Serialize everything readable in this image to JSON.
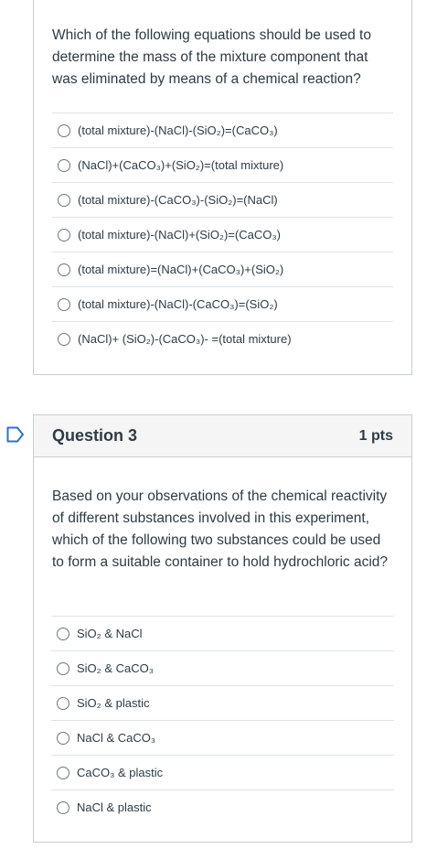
{
  "question2": {
    "text": "Which of the following equations should be used to determine the mass of the mixture component that was eliminated by means of a chemical reaction?",
    "answers": [
      "(total mixture)-(NaCl)-(SiO₂)=(CaCO₃)",
      "(NaCl)+(CaCO₃)+(SiO₂)=(total mixture)",
      "(total mixture)-(CaCO₃)-(SiO₂)=(NaCl)",
      "(total mixture)-(NaCl)+(SiO₂)=(CaCO₃)",
      "(total mixture)=(NaCl)+(CaCO₃)+(SiO₂)",
      "(total mixture)-(NaCl)-(CaCO₃)=(SiO₂)",
      "(NaCl)+ (SiO₂)-(CaCO₃)- =(total mixture)"
    ]
  },
  "question3": {
    "title": "Question 3",
    "points": "1 pts",
    "text": "Based on your observations of the chemical reactivity of different substances involved in this experiment, which of the following two substances could be used to form a suitable container to hold hydrochloric acid?",
    "answers": [
      "SiO₂ & NaCl",
      "SiO₂ & CaCO₃",
      "SiO₂ & plastic",
      "NaCl & CaCO₃",
      "CaCO₃ & plastic",
      "NaCl & plastic"
    ]
  },
  "colors": {
    "flag": "#2d6fd1",
    "border": "#c7cdd1",
    "header_bg": "#f5f5f5",
    "text": "#2d3b45"
  },
  "icons": {
    "flag": "flag-icon",
    "radio": "radio-button-icon"
  }
}
